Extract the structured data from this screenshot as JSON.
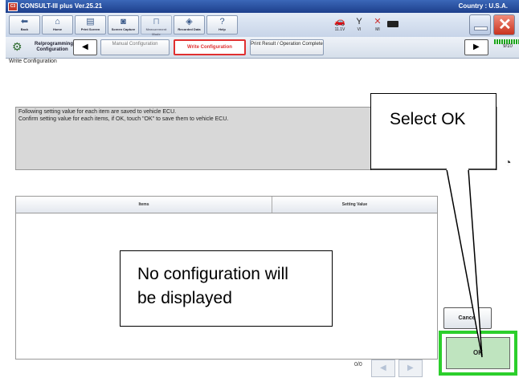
{
  "app": {
    "title": "CONSULT-III plus  Ver.25.21",
    "country": "Country : U.S.A."
  },
  "toolbar": {
    "buttons": [
      {
        "label": "Back",
        "icon": "back-icon"
      },
      {
        "label": "Home",
        "icon": "home-icon"
      },
      {
        "label": "Print Screen",
        "icon": "print-icon"
      },
      {
        "label": "Screen Capture",
        "icon": "camera-icon"
      },
      {
        "label": "Measurement Mode",
        "icon": "measure-icon"
      },
      {
        "label": "Recorded Data",
        "icon": "recorded-data-icon"
      },
      {
        "label": "Help",
        "icon": "help-icon"
      }
    ],
    "status": [
      {
        "label": "11.1V",
        "icon": "car-battery-icon"
      },
      {
        "label": "VI",
        "icon": "vi-signal-icon"
      },
      {
        "label": "MI",
        "icon": "mi-disconnected-icon"
      }
    ]
  },
  "nav": {
    "title": "Re/programming, Configuration",
    "steps": [
      {
        "label": "Manual Configuration",
        "state": "done"
      },
      {
        "label": "Write Configuration",
        "state": "active"
      },
      {
        "label": "Print Result / Operation Complete",
        "state": "next"
      }
    ],
    "progress": "9/10"
  },
  "page": {
    "title": "Write Configuration",
    "message_line1": "Following setting value for each item are saved to vehicle ECU.",
    "message_line2": "Confirm setting value for each items, if OK, touch \"OK\" to save them to vehicle ECU."
  },
  "table": {
    "columns": [
      "Items",
      "Setting Value"
    ],
    "rows": []
  },
  "pager": {
    "text": "0/0"
  },
  "buttons": {
    "cancel": "Cancel",
    "ok": "OK"
  },
  "callouts": {
    "select_ok": "Select OK",
    "no_config_line1": "No configuration will",
    "no_config_line2": "be displayed"
  },
  "colors": {
    "active_step": "#e03030",
    "ok_highlight": "#2ccf2c",
    "ok_button": "#bfe4bf"
  }
}
